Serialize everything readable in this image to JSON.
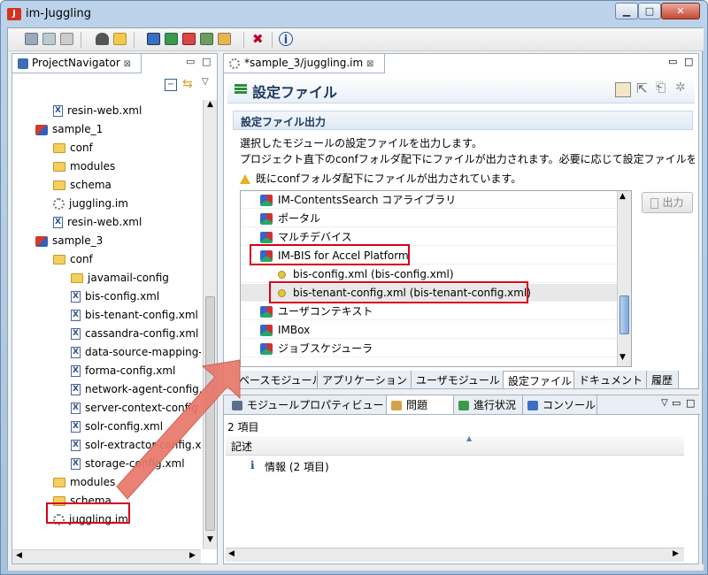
{
  "window": {
    "title": "im-Juggling",
    "app_icon_glyph": "J"
  },
  "toolbar": {
    "icons": [
      "save-icon",
      "save-all-icon",
      "print-icon",
      "server-icon",
      "open-folder-icon",
      "monitor-icon",
      "run-icon",
      "deploy-icon",
      "image-icon",
      "tree-icon",
      "tools-icon",
      "info-icon"
    ]
  },
  "navigator": {
    "tab_label": "ProjectNavigator",
    "items": [
      {
        "label": "resin-web.xml",
        "icon": "xml-file-icon",
        "indent": 2
      },
      {
        "label": "sample_1",
        "icon": "project-icon",
        "indent": 1
      },
      {
        "label": "conf",
        "icon": "folder-icon",
        "indent": 2
      },
      {
        "label": "modules",
        "icon": "folder-icon",
        "indent": 2
      },
      {
        "label": "schema",
        "icon": "folder-icon",
        "indent": 2
      },
      {
        "label": "juggling.im",
        "icon": "gear-icon",
        "indent": 2
      },
      {
        "label": "resin-web.xml",
        "icon": "xml-file-icon",
        "indent": 2
      },
      {
        "label": "sample_3",
        "icon": "project-icon",
        "indent": 1
      },
      {
        "label": "conf",
        "icon": "folder-icon",
        "indent": 2
      },
      {
        "label": "javamail-config",
        "icon": "folder-icon",
        "indent": 3
      },
      {
        "label": "bis-config.xml",
        "icon": "xml-file-icon",
        "indent": 3
      },
      {
        "label": "bis-tenant-config.xml",
        "icon": "xml-file-icon",
        "indent": 3
      },
      {
        "label": "cassandra-config.xml",
        "icon": "xml-file-icon",
        "indent": 3
      },
      {
        "label": "data-source-mapping-c",
        "icon": "xml-file-icon",
        "indent": 3
      },
      {
        "label": "forma-config.xml",
        "icon": "xml-file-icon",
        "indent": 3
      },
      {
        "label": "network-agent-config.",
        "icon": "xml-file-icon",
        "indent": 3
      },
      {
        "label": "server-context-config",
        "icon": "xml-file-icon",
        "indent": 3
      },
      {
        "label": "solr-config.xml",
        "icon": "xml-file-icon",
        "indent": 3
      },
      {
        "label": "solr-extractor-config.x",
        "icon": "xml-file-icon",
        "indent": 3
      },
      {
        "label": "storage-config.xml",
        "icon": "xml-file-icon",
        "indent": 3
      },
      {
        "label": "modules",
        "icon": "folder-icon",
        "indent": 2
      },
      {
        "label": "schema",
        "icon": "folder-icon",
        "indent": 2
      },
      {
        "label": "juggling.im",
        "icon": "gear-icon",
        "indent": 2
      }
    ]
  },
  "editor": {
    "tab_label": "*sample_3/juggling.im",
    "header_title": "設定ファイル",
    "section_title": "設定ファイル出力",
    "desc_line1": "選択したモジュールの設定ファイルを出力します。",
    "desc_line2": "プロジェクト直下のconfフォルダ配下にファイルが出力されます。必要に応じて設定ファイルを",
    "warning": "既にconfフォルダ配下にファイルが出力されています。",
    "output_button": "出力",
    "list": [
      {
        "label": "IM-ContentsSearch コアライブラリ",
        "kind": "module"
      },
      {
        "label": "ポータル",
        "kind": "module"
      },
      {
        "label": "マルチデバイス",
        "kind": "module"
      },
      {
        "label": "IM-BIS for Accel Platform",
        "kind": "module"
      },
      {
        "label": "bis-config.xml (bis-config.xml)",
        "kind": "file"
      },
      {
        "label": "bis-tenant-config.xml (bis-tenant-config.xml)",
        "kind": "file"
      },
      {
        "label": "ユーザコンテキスト",
        "kind": "module"
      },
      {
        "label": "IMBox",
        "kind": "module"
      },
      {
        "label": "ジョブスケジューラ",
        "kind": "module"
      }
    ],
    "bottom_tabs": [
      "ベースモジュール",
      "アプリケーション",
      "ユーザモジュール",
      "設定ファイル",
      "ドキュメント",
      "履歴"
    ],
    "active_bottom_tab": "設定ファイル"
  },
  "problems": {
    "tabs": [
      "モジュールプロパティビュー",
      "問題",
      "進行状況",
      "コンソール"
    ],
    "count": "2 項目",
    "column": "記述",
    "row": "情報 (2 項目)"
  },
  "colors": {
    "highlight": "#d6001c",
    "arrow": "#e8786a",
    "selection": "#e8e8e8"
  }
}
